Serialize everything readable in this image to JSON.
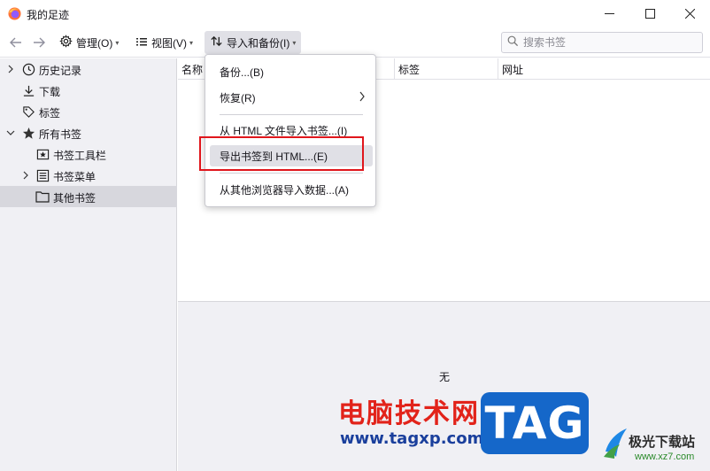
{
  "window": {
    "title": "我的足迹"
  },
  "toolbar": {
    "manage_label": "管理(O)",
    "views_label": "视图(V)",
    "import_backup_label": "导入和备份(I)",
    "search_placeholder": "搜索书签"
  },
  "sidebar": {
    "items": [
      {
        "label": "历史记录",
        "icon": "clock-icon",
        "expandable": true
      },
      {
        "label": "下载",
        "icon": "download-icon",
        "expandable": false
      },
      {
        "label": "标签",
        "icon": "tag-icon",
        "expandable": false
      },
      {
        "label": "所有书签",
        "icon": "star-icon",
        "expandable": true,
        "expanded": true
      },
      {
        "label": "书签工具栏",
        "icon": "bookmark-toolbar-icon",
        "expandable": false
      },
      {
        "label": "书签菜单",
        "icon": "bookmark-menu-icon",
        "expandable": true
      },
      {
        "label": "其他书签",
        "icon": "folder-icon",
        "expandable": false,
        "selected": true
      }
    ]
  },
  "table": {
    "columns": [
      "名称",
      "标签",
      "网址"
    ]
  },
  "details": {
    "empty_text": "无"
  },
  "menu": {
    "items": [
      {
        "label": "备份...(B)"
      },
      {
        "label": "恢复(R)",
        "submenu": true
      },
      {
        "label": "从 HTML 文件导入书签...(I)"
      },
      {
        "label": "导出书签到 HTML...(E)",
        "highlighted": true
      },
      {
        "label": "从其他浏览器导入数据...(A)"
      }
    ]
  },
  "watermark": {
    "text": "电脑技术网",
    "url": "www.tagxp.com",
    "tag": "TAG",
    "site_name": "极光下载站",
    "site_url": "www.xz7.com"
  },
  "colors": {
    "highlight_box": "#e0161c",
    "selected_row": "#d7d7dd",
    "sidebar_bg": "#f0f0f4"
  }
}
